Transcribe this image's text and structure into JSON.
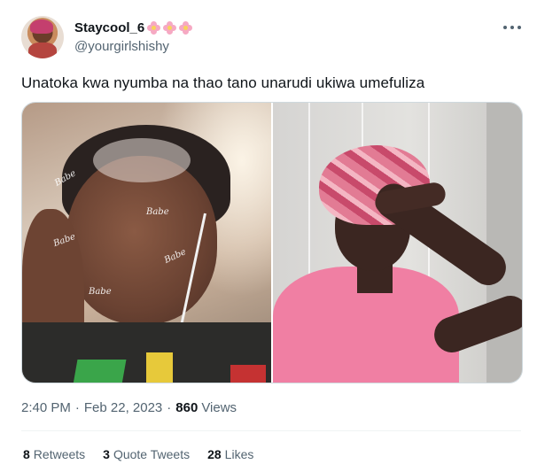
{
  "author": {
    "display_name": "Staycool_6",
    "handle": "@yourgirlshishy",
    "name_emoji": "flower-emoji x3",
    "avatar": "avatar-photo"
  },
  "more_icon": "more-horizontal-icon",
  "tweet": {
    "text": "Unatoka kwa nyumba na thao tano unarudi ukiwa umefuliza",
    "media": {
      "left_photo": "woman-crying-selfie",
      "left_stickers": [
        "Babe",
        "Babe",
        "Babe",
        "Babe",
        "Babe"
      ],
      "right_photo": "woman-pink-top-hand-on-forehead"
    }
  },
  "meta": {
    "time": "2:40 PM",
    "separator": "·",
    "date": "Feb 22, 2023",
    "views_count": "860",
    "views_label": "Views"
  },
  "stats": {
    "retweets_count": "8",
    "retweets_label": "Retweets",
    "quotes_count": "3",
    "quotes_label": "Quote Tweets",
    "likes_count": "28",
    "likes_label": "Likes"
  },
  "colors": {
    "text_primary": "#0f1419",
    "text_secondary": "#536471",
    "border": "#cfd9de",
    "divider": "#eff3f4"
  }
}
